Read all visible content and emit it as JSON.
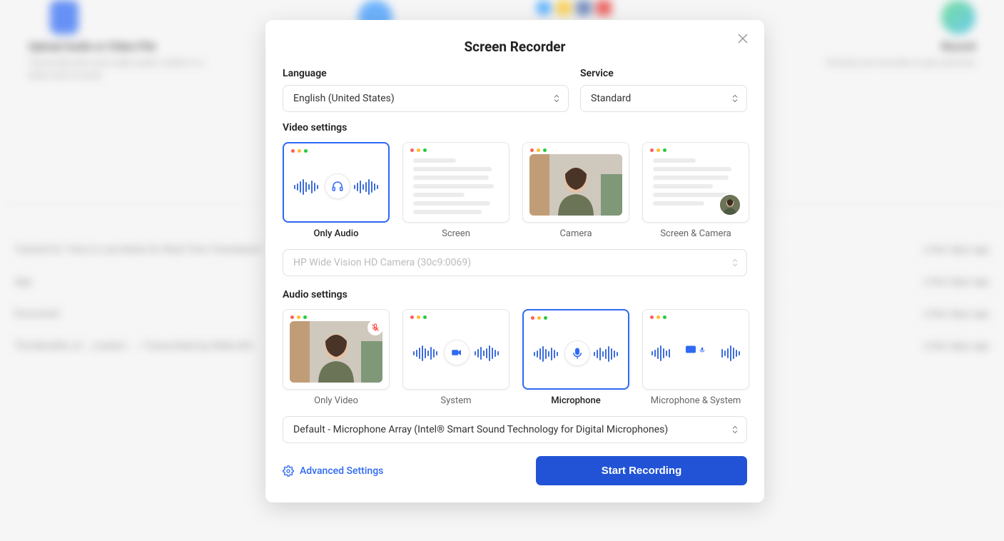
{
  "modal": {
    "title": "Screen Recorder",
    "language_label": "Language",
    "language_value": "English (United States)",
    "service_label": "Service",
    "service_value": "Standard",
    "video_settings_label": "Video settings",
    "audio_settings_label": "Audio settings",
    "camera_device": "HP Wide Vision HD Camera (30c9:0069)",
    "mic_device": "Default - Microphone Array (Intel® Smart Sound Technology for Digital Microphones)",
    "advanced_settings": "Advanced Settings",
    "start_recording": "Start Recording",
    "video_options": [
      {
        "label": "Only Audio"
      },
      {
        "label": "Screen"
      },
      {
        "label": "Camera"
      },
      {
        "label": "Screen & Camera"
      }
    ],
    "audio_options": [
      {
        "label": "Only Video"
      },
      {
        "label": "System"
      },
      {
        "label": "Microphone"
      },
      {
        "label": "Microphone & System"
      }
    ]
  },
  "background": {
    "card1_title": "Upload Audio or Video File",
    "card1_sub": "Transcribe text and make audio visible in a blink with AI tools.",
    "card4_title": "Record",
    "card4_sub": "Directly use recorder to get real-time",
    "tutorial": "Tutorial for \"How to use Notta for Real-Time Translation\"",
    "row_time": "a few days ago"
  }
}
